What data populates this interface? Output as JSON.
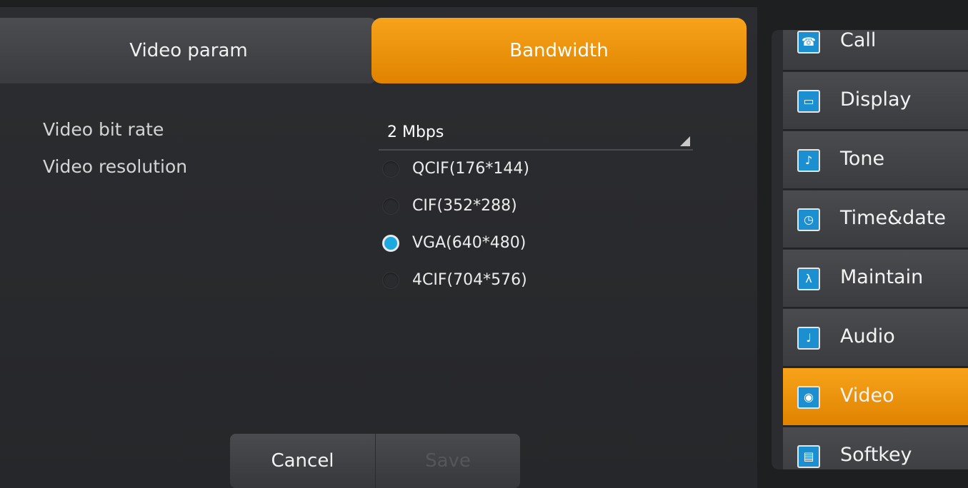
{
  "tabs": [
    {
      "label": "Video param",
      "active": false
    },
    {
      "label": "Bandwidth",
      "active": true
    }
  ],
  "form": {
    "bitrate_label": "Video bit rate",
    "bitrate_value": "2 Mbps",
    "resolution_label": "Video resolution",
    "resolutions": [
      {
        "label": "QCIF(176*144)",
        "checked": false
      },
      {
        "label": "CIF(352*288)",
        "checked": false
      },
      {
        "label": "VGA(640*480)",
        "checked": true
      },
      {
        "label": "4CIF(704*576)",
        "checked": false
      }
    ]
  },
  "buttons": {
    "cancel": "Cancel",
    "save": "Save"
  },
  "sidebar": {
    "items": [
      {
        "label": "Call",
        "icon": "call-icon"
      },
      {
        "label": "Display",
        "icon": "display-icon"
      },
      {
        "label": "Tone",
        "icon": "tone-icon"
      },
      {
        "label": "Time&date",
        "icon": "clock-icon"
      },
      {
        "label": "Maintain",
        "icon": "maintain-icon"
      },
      {
        "label": "Audio",
        "icon": "microphone-icon"
      },
      {
        "label": "Video",
        "icon": "video-icon",
        "active": true
      },
      {
        "label": "Softkey",
        "icon": "softkey-icon"
      }
    ]
  },
  "colors": {
    "accent": "#f09a10",
    "radio_checked": "#1ea8e0",
    "background": "#2a2b2e"
  }
}
